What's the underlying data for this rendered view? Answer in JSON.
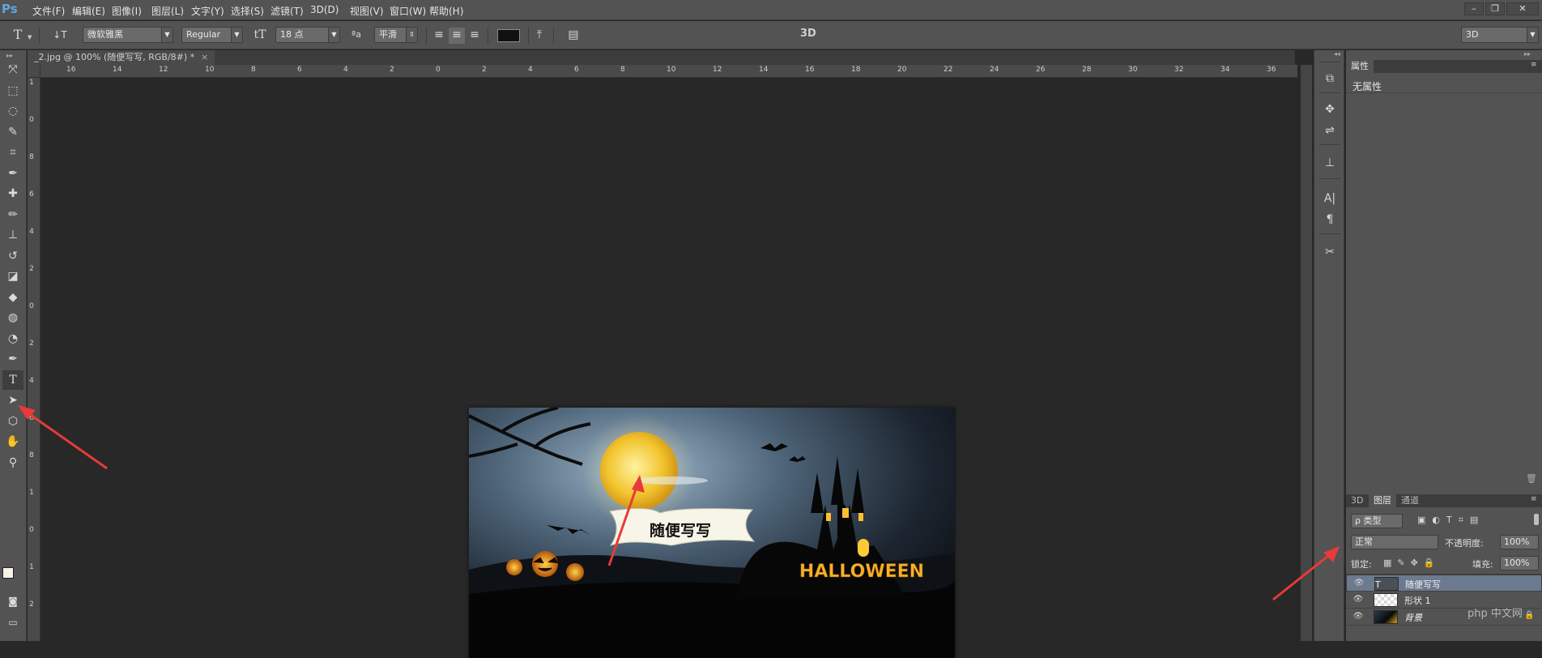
{
  "app": {
    "logo": "Ps"
  },
  "menu": [
    "文件(F)",
    "编辑(E)",
    "图像(I)",
    "图层(L)",
    "文字(Y)",
    "选择(S)",
    "滤镜(T)",
    "3D(D)",
    "视图(V)",
    "窗口(W)",
    "帮助(H)"
  ],
  "window_controls": {
    "minimize": "–",
    "restore": "❐",
    "close": "✕"
  },
  "options": {
    "tool_icon": "T",
    "font_family": "微软雅黑",
    "font_style": "Regular",
    "font_size": "18 点",
    "aa_label": "ªa",
    "antialias": "平滑",
    "mode_3d": "3D",
    "workspace": "3D",
    "text_color": "#111111"
  },
  "document": {
    "tab_title": "_2.jpg @ 100% (随便写写, RGB/8#) *",
    "tab_close": "×",
    "banner_text": "随便写写",
    "halloween_text": "HALLOWEEN"
  },
  "rulers": {
    "horizontal": [
      "16",
      "14",
      "12",
      "10",
      "8",
      "6",
      "4",
      "2",
      "0",
      "2",
      "4",
      "6",
      "8",
      "10",
      "12",
      "14",
      "16",
      "18",
      "20",
      "22",
      "24",
      "26",
      "28",
      "30",
      "32",
      "34",
      "36"
    ],
    "vertical": [
      "1",
      "0",
      "8",
      "6",
      "4",
      "2",
      "0",
      "2",
      "4",
      "6",
      "8",
      "1",
      "0",
      "1",
      "2"
    ]
  },
  "tools": [
    "move-icon",
    "marquee-icon",
    "lasso-icon",
    "quick-select-icon",
    "crop-icon",
    "eyedropper-icon",
    "healing-icon",
    "brush-icon",
    "stamp-icon",
    "history-brush-icon",
    "eraser-icon",
    "bucket-icon",
    "blur-icon",
    "dodge-icon",
    "pen-icon",
    "type-icon",
    "path-select-icon",
    "shape-icon",
    "hand-icon",
    "zoom-icon"
  ],
  "properties_panel": {
    "tab": "属性",
    "empty": "无属性"
  },
  "layers_panel": {
    "tabs": [
      "3D",
      "图层",
      "通道"
    ],
    "filter": "ρ 类型",
    "blend_mode": "正常",
    "opacity_label": "不透明度:",
    "opacity_value": "100%",
    "lock_label": "锁定:",
    "fill_label": "填充:",
    "fill_value": "100%",
    "layers": [
      {
        "name": "随便写写",
        "type": "text",
        "selected": true
      },
      {
        "name": "形状 1",
        "type": "shape",
        "selected": false
      },
      {
        "name": "背景",
        "type": "image",
        "selected": false,
        "locked": true
      }
    ]
  },
  "watermark": "php 中文网",
  "colors": {
    "accent_arrow": "#e83a3a",
    "selected_layer": "#6c7a8f"
  }
}
